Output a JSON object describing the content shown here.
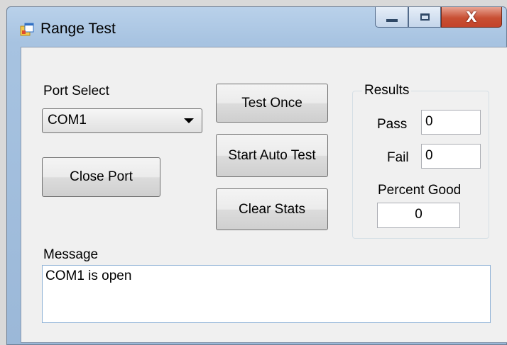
{
  "window": {
    "title": "Range Test",
    "close_glyph": "X"
  },
  "port_select": {
    "label": "Port Select",
    "selected": "COM1"
  },
  "buttons": {
    "close_port": "Close Port",
    "test_once": "Test Once",
    "start_auto_test": "Start Auto Test",
    "clear_stats": "Clear Stats"
  },
  "results": {
    "group_label": "Results",
    "pass_label": "Pass",
    "pass_value": "0",
    "fail_label": "Fail",
    "fail_value": "0",
    "percent_label": "Percent Good",
    "percent_value": "0"
  },
  "message": {
    "label": "Message",
    "text": "COM1 is open"
  },
  "icons": {
    "app": "app-window-icon",
    "dropdown": "chevron-down-icon"
  },
  "colors": {
    "titlebar": "#b9d1ea",
    "close_button": "#c84f33",
    "client": "#f0f0f0"
  }
}
